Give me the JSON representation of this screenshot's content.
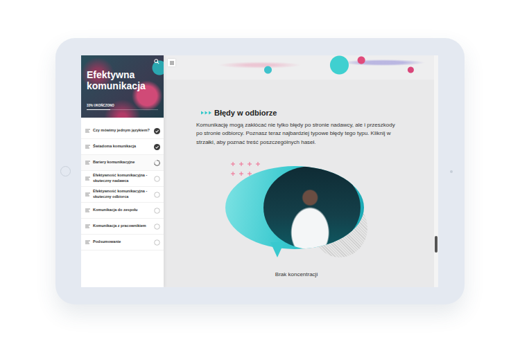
{
  "course": {
    "title": "Efektywna komunikacja",
    "progress_text": "33% UKOŃCZONO",
    "progress": {
      "level": 0.33
    }
  },
  "sidebar": {
    "items": [
      {
        "label": "Czy mówimy jednym językiem?",
        "completed": true,
        "in_progress": false,
        "selected": false
      },
      {
        "label": "Świadoma komunikacja",
        "completed": true,
        "in_progress": false,
        "selected": false
      },
      {
        "label": "Bariery komunikacyjne",
        "completed": false,
        "in_progress": true,
        "selected": true
      },
      {
        "label": "Efektywność komunikacyjna - skuteczny nadawca",
        "completed": false,
        "in_progress": false,
        "selected": false
      },
      {
        "label": "Efektywność komunikacyjna - skuteczny odbiorca",
        "completed": false,
        "in_progress": false,
        "selected": false
      },
      {
        "label": "Komunikacja do zespołu",
        "completed": false,
        "in_progress": false,
        "selected": false
      },
      {
        "label": "Komunikacja z pracownikiem",
        "completed": false,
        "in_progress": false,
        "selected": false
      },
      {
        "label": "Podsumowanie",
        "completed": false,
        "in_progress": false,
        "selected": false
      }
    ]
  },
  "content": {
    "heading": "Błędy w odbiorze",
    "paragraph": "Komunikację mogą zakłócać nie tylko błędy po stronie nadawcy, ale i przeszkody po stronie odbiorcy. Poznasz teraz najbardziej typowe błędy tego typu. Kliknij w strzałki, aby poznać treść poszczególnych haseł.",
    "card_caption": "Brak koncentracji"
  },
  "scrollbar": {
    "level": 0.85
  }
}
